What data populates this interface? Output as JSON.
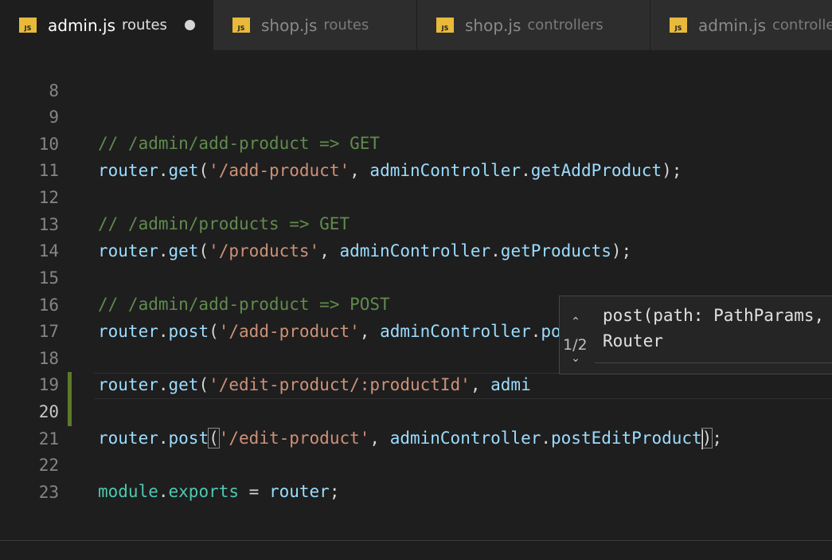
{
  "tabs": [
    {
      "name": "admin.js",
      "dir": "routes",
      "active": true,
      "dirty": true,
      "icon": "JS"
    },
    {
      "name": "shop.js",
      "dir": "routes",
      "active": false,
      "dirty": false,
      "icon": "JS"
    },
    {
      "name": "shop.js",
      "dir": "controllers",
      "active": false,
      "dirty": false,
      "icon": "JS"
    },
    {
      "name": "admin.js",
      "dir": "controllers",
      "active": false,
      "dirty": false,
      "icon": "JS"
    }
  ],
  "editor": {
    "current_line": "20",
    "lines": [
      {
        "n": "8"
      },
      {
        "n": "9",
        "c1": "// /admin/add-product => GET"
      },
      {
        "n": "10",
        "c1": "router",
        "c2": ".",
        "c3": "get",
        "c4": "(",
        "c5": "'/add-product'",
        "c6": ", ",
        "c7": "adminController",
        "c8": ".",
        "c9": "getAddProduct",
        "c10": ");"
      },
      {
        "n": "11"
      },
      {
        "n": "12",
        "c1": "// /admin/products => GET"
      },
      {
        "n": "13",
        "c1": "router",
        "c2": ".",
        "c3": "get",
        "c4": "(",
        "c5": "'/products'",
        "c6": ", ",
        "c7": "adminController",
        "c8": ".",
        "c9": "getProducts",
        "c10": ");"
      },
      {
        "n": "14"
      },
      {
        "n": "15",
        "c1": "// /admin/add-product => POST"
      },
      {
        "n": "16",
        "c1": "router",
        "c2": ".",
        "c3": "post",
        "c4": "(",
        "c5": "'/add-product'",
        "c6": ", ",
        "c7": "adminController",
        "c8": ".",
        "c9": "postAddProduct",
        "c10": ");"
      },
      {
        "n": "17"
      },
      {
        "n": "18",
        "c1": "router",
        "c2": ".",
        "c3": "get",
        "c4": "(",
        "c5": "'/edit-product/:productId'",
        "c6": ", ",
        "c7": "admi"
      },
      {
        "n": "19"
      },
      {
        "n": "20",
        "c1": "router",
        "c2": ".",
        "c3": "post",
        "c4": "(",
        "c5": "'/edit-product'",
        "c6": ", ",
        "c7": "adminController",
        "c8": ".",
        "c9": "postEditProduct",
        "c10": ")",
        "c11": ";"
      },
      {
        "n": "21"
      },
      {
        "n": "22",
        "c1": "module",
        "c2": ".",
        "c3": "exports",
        "c4": " = ",
        "c5": "router",
        "c6": ";"
      },
      {
        "n": "23"
      }
    ]
  },
  "hover": {
    "signature": "post(path: PathParams,",
    "returns": "Router",
    "counter": "1/2",
    "up_icon": "chevron-up-icon",
    "down_icon": "chevron-down-icon"
  },
  "colors": {
    "background": "#1e1e1e",
    "comment": "#608b4e",
    "string": "#ce9178",
    "identifier": "#9cdcfe",
    "js_badge": "#e8b93a",
    "modified_gutter": "#5d7a2a"
  }
}
